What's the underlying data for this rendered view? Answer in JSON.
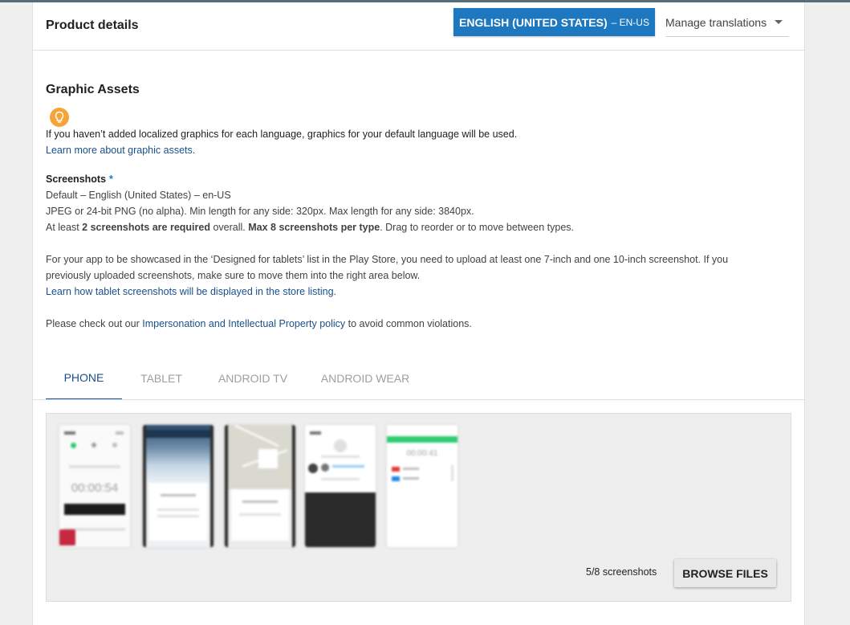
{
  "header": {
    "title": "Product details",
    "language_button": {
      "label": "ENGLISH (UNITED STATES)",
      "code": "– EN-US"
    },
    "manage_translations": "Manage translations"
  },
  "graphic_assets": {
    "title": "Graphic Assets",
    "tip_icon": "lightbulb-icon",
    "tip_text": "If you haven’t added localized graphics for each language, graphics for your default language will be used.",
    "learn_more": "Learn more about graphic assets."
  },
  "screenshots": {
    "label": "Screenshots",
    "required_marker": "*",
    "default_language": "Default – English (United States) – en-US",
    "format": "JPEG or 24-bit PNG (no alpha). Min length for any side: 320px. Max length for any side: 3840px.",
    "requirement_prefix": "At least",
    "requirement_bold1": "2 screenshots are required",
    "requirement_mid": "overall.",
    "requirement_bold2": "Max 8 screenshots per type",
    "requirement_suffix": ". Drag to reorder or to move between types.",
    "tablets_line1": "For your app to be showcased in the ‘Designed for tablets’ list in the Play Store, you need to upload at least one 7-inch and one 10-inch screenshot. If you",
    "tablets_line2": "previously uploaded screenshots, make sure to move them into the right area below.",
    "tablets_link": "Learn how tablet screenshots will be displayed in the store listing.",
    "policy_prefix": "Please check out our",
    "policy_link": "Impersonation and Intellectual Property policy",
    "policy_suffix": "to avoid common violations."
  },
  "tabs": [
    {
      "label": "PHONE",
      "active": true
    },
    {
      "label": "TABLET",
      "active": false
    },
    {
      "label": "ANDROID TV",
      "active": false
    },
    {
      "label": "ANDROID WEAR",
      "active": false
    }
  ],
  "gallery": {
    "count_text": "5/8 screenshots",
    "browse_label": "BROWSE FILES",
    "thumbnails": [
      {
        "timer": "00:00:54"
      },
      {
        "timer": ""
      },
      {
        "timer": ""
      },
      {
        "timer": ""
      },
      {
        "timer": "00:00:41"
      }
    ]
  },
  "colors": {
    "accent": "#1e78bf",
    "link": "#1a4f8b",
    "tip": "#f5a43b",
    "active_tab": "#1a4f8b"
  }
}
